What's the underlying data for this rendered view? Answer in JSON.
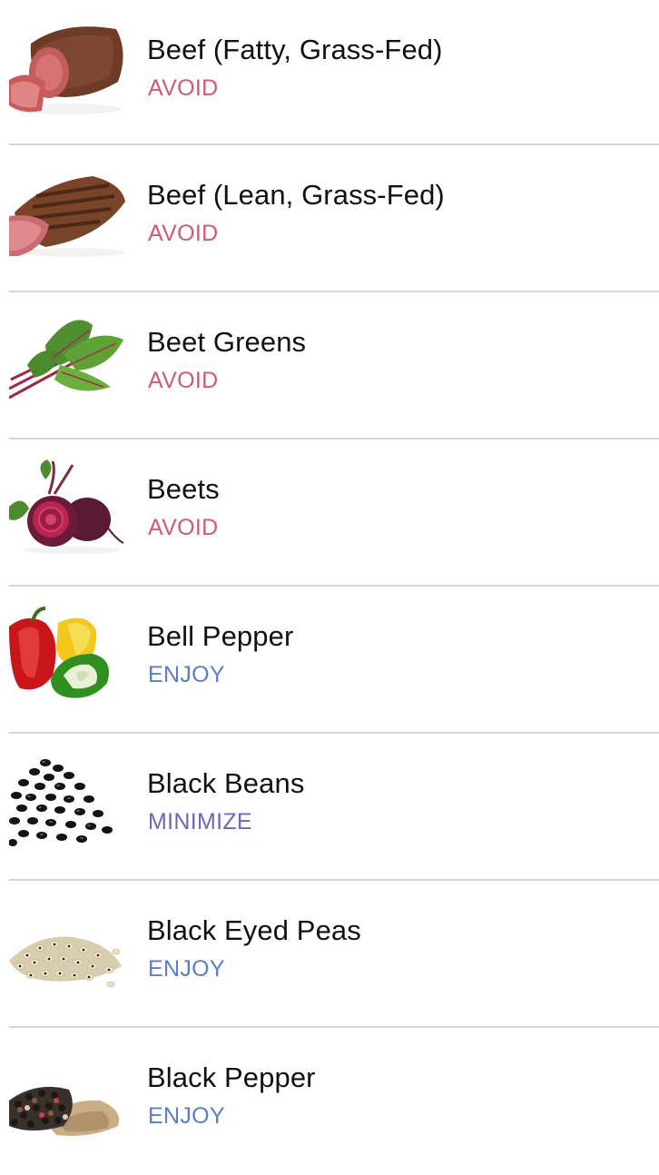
{
  "colors": {
    "avoid": "#cf5a72",
    "enjoy": "#5a7fc6",
    "minimize": "#6d68b5",
    "divider": "#d5d5d5"
  },
  "foods": [
    {
      "name": "Beef (Fatty, Grass-Fed)",
      "status": "AVOID",
      "image_icon": "beef-roast-icon"
    },
    {
      "name": "Beef (Lean, Grass-Fed)",
      "status": "AVOID",
      "image_icon": "beef-steak-icon"
    },
    {
      "name": "Beet Greens",
      "status": "AVOID",
      "image_icon": "beet-greens-icon"
    },
    {
      "name": "Beets",
      "status": "AVOID",
      "image_icon": "beets-icon"
    },
    {
      "name": "Bell Pepper",
      "status": "ENJOY",
      "image_icon": "bell-pepper-icon"
    },
    {
      "name": "Black Beans",
      "status": "MINIMIZE",
      "image_icon": "black-beans-icon"
    },
    {
      "name": "Black Eyed Peas",
      "status": "ENJOY",
      "image_icon": "black-eyed-peas-icon"
    },
    {
      "name": "Black Pepper",
      "status": "ENJOY",
      "image_icon": "black-pepper-icon"
    }
  ]
}
